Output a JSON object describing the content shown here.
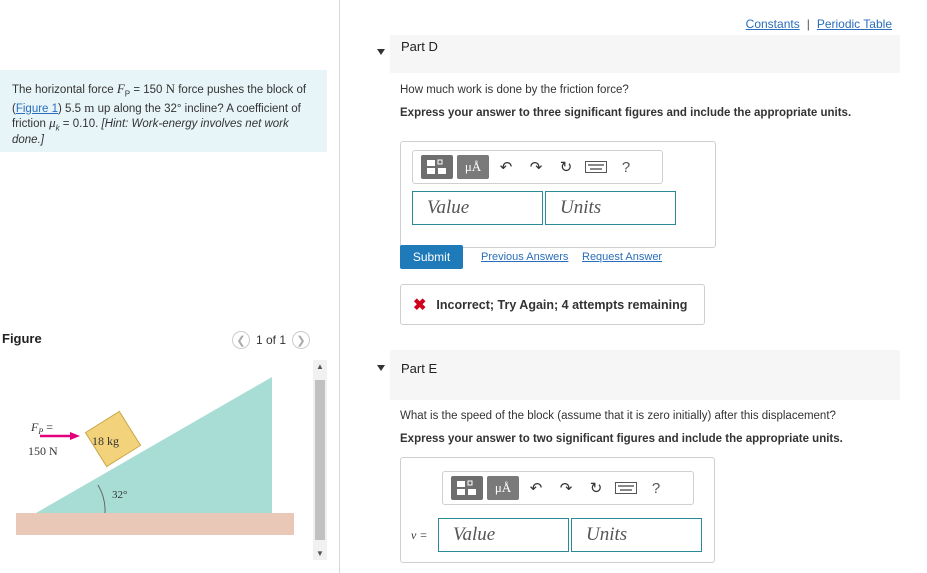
{
  "problem": {
    "text_1": "The horizontal force ",
    "force_symbol": "F",
    "force_sub": "P",
    "text_2": " = 150 ",
    "force_unit": "N",
    "text_3": " force pushes the block of (",
    "figure_link": "Figure 1",
    "text_4": ") 5.5 ",
    "dist_unit": "m",
    "text_5": " up along the 32° incline? A coefficient of friction ",
    "mu": "μ",
    "mu_sub": "k",
    "text_6": " = 0.10. ",
    "hint": "[Hint: Work-energy involves net work done.]"
  },
  "figure": {
    "label": "Figure",
    "pager_text": "1 of 1",
    "force_label": "F",
    "force_sub": "P",
    "force_eq": " =",
    "force_value": "150 N",
    "mass_label": "18 kg",
    "angle_label": "32°"
  },
  "links": {
    "constants": "Constants",
    "separator": "|",
    "periodic_table": "Periodic Table"
  },
  "part_d": {
    "title": "Part D",
    "question": "How much work is done by the friction force?",
    "instruction": "Express your answer to three significant figures and include the appropriate units.",
    "value_placeholder": "Value",
    "units_placeholder": "Units",
    "submit_label": "Submit",
    "previous_answers": "Previous Answers",
    "request_answer": "Request Answer",
    "feedback": "Incorrect; Try Again; 4 attempts remaining",
    "toolbar_mu": "μÅ",
    "toolbar_help": "?"
  },
  "part_e": {
    "title": "Part E",
    "question": "What is the speed of the block (assume that it is zero initially) after this displacement?",
    "instruction": "Express your answer to two significant figures and include the appropriate units.",
    "var_label": "v =",
    "value_placeholder": "Value",
    "units_placeholder": "Units",
    "toolbar_mu": "μÅ",
    "toolbar_help": "?"
  },
  "colors": {
    "link": "#2a6ebb",
    "submit": "#1e7ab8",
    "incline": "#a8ddd6",
    "ground": "#e9c8b7",
    "block": "#f2d27a",
    "force_arrow": "#e4007c",
    "error": "#d0021b"
  },
  "icons": [
    "templates-icon",
    "units-symbol-icon",
    "undo-icon",
    "redo-icon",
    "reset-icon",
    "keyboard-icon",
    "help-icon",
    "close-x-icon",
    "chevron-left-icon",
    "chevron-right-icon"
  ]
}
